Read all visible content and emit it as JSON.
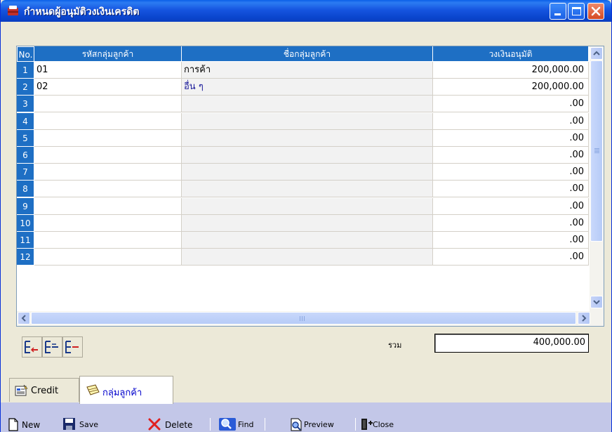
{
  "window": {
    "title": "กำหนดผู้อนุมัติวงเงินเครดิต",
    "minimize_icon": "minimize-icon",
    "maximize_icon": "maximize-icon",
    "close_icon": "close-icon"
  },
  "grid": {
    "columns": [
      "No.",
      "รหัสกลุ่มลูกค้า",
      "ชื่อกลุ่มลูกค้า",
      "วงเงินอนุมัติ"
    ],
    "rows": [
      {
        "no": "1",
        "code": "01",
        "name": "การค้า",
        "amount": "200,000.00"
      },
      {
        "no": "2",
        "code": "02",
        "name": "อื่น ๆ",
        "amount": "200,000.00"
      },
      {
        "no": "3",
        "code": "",
        "name": "",
        "amount": ".00"
      },
      {
        "no": "4",
        "code": "",
        "name": "",
        "amount": ".00"
      },
      {
        "no": "5",
        "code": "",
        "name": "",
        "amount": ".00"
      },
      {
        "no": "6",
        "code": "",
        "name": "",
        "amount": ".00"
      },
      {
        "no": "7",
        "code": "",
        "name": "",
        "amount": ".00"
      },
      {
        "no": "8",
        "code": "",
        "name": "",
        "amount": ".00"
      },
      {
        "no": "9",
        "code": "",
        "name": "",
        "amount": ".00"
      },
      {
        "no": "10",
        "code": "",
        "name": "",
        "amount": ".00"
      },
      {
        "no": "11",
        "code": "",
        "name": "",
        "amount": ".00"
      },
      {
        "no": "12",
        "code": "",
        "name": "",
        "amount": ".00"
      }
    ]
  },
  "footer": {
    "total_label": "รวม",
    "total_value": "400,000.00"
  },
  "tabs": [
    {
      "label": "Credit",
      "active": false
    },
    {
      "label": "กลุ่มลูกค้า",
      "active": true
    }
  ],
  "toolbar": {
    "new_label": "New",
    "save_label": "Save",
    "delete_label": "Delete",
    "find_label": "Find",
    "preview_label": "Preview",
    "close_label": "Close"
  },
  "colors": {
    "titlebar": "#1655e0",
    "grid_header": "#1e6fc4",
    "window_bg": "#ece9d8",
    "tab_strip": "#c3c7e8"
  }
}
